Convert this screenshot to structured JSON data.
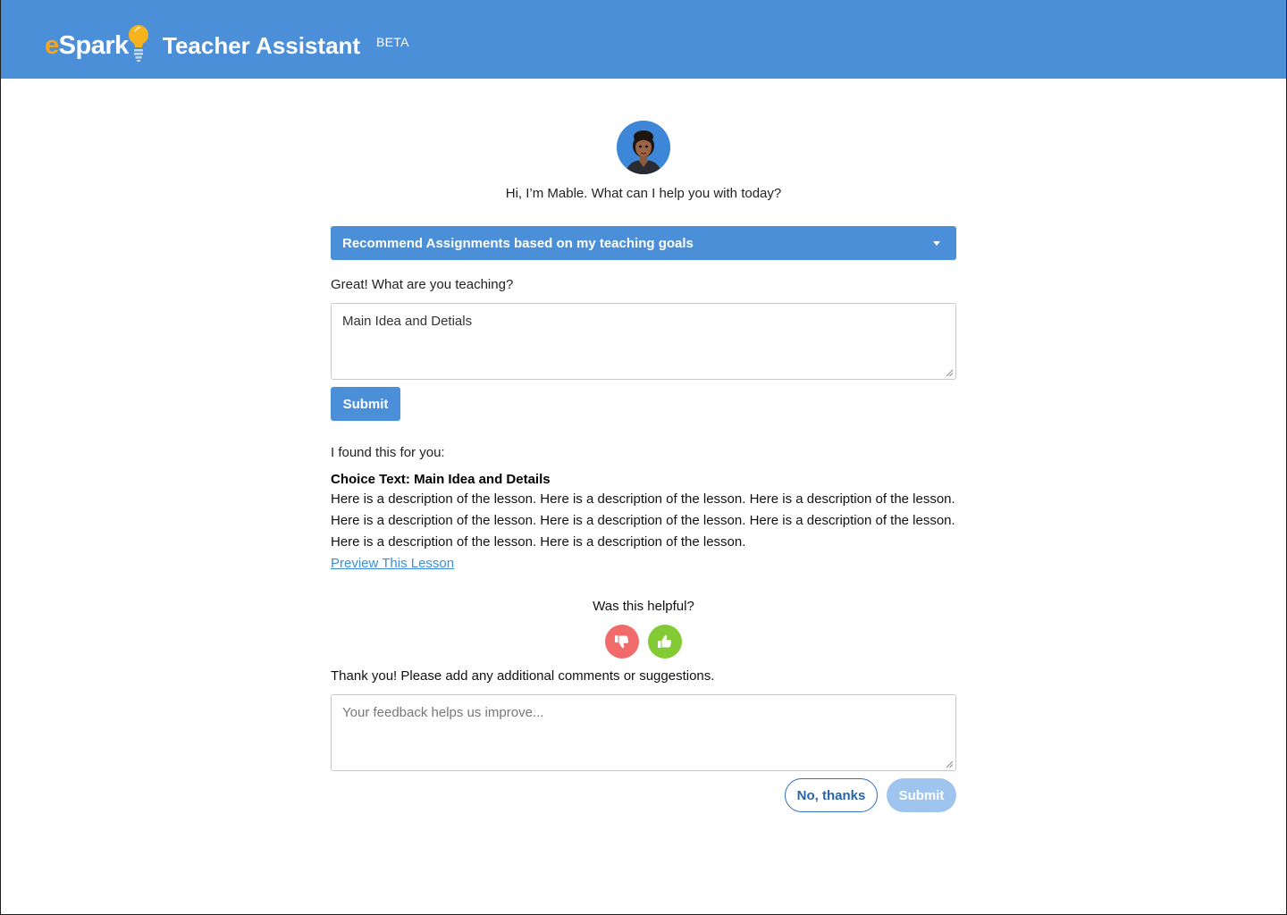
{
  "header": {
    "logo_e": "e",
    "logo_spark": "Spark",
    "title": "Teacher Assistant",
    "badge": "BETA",
    "bg_color": "#4a8fd8"
  },
  "assistant": {
    "greeting": "Hi, I’m Mable. What can I help you with today?"
  },
  "task_select": {
    "selected": "Recommend Assignments based on my teaching goals"
  },
  "teaching_form": {
    "question": "Great! What are you teaching?",
    "value": "Main Idea and Detials",
    "submit_label": "Submit"
  },
  "result": {
    "intro": "I found this for you:",
    "title": "Choice Text: Main Idea and Details",
    "description": "Here is a description of the lesson. Here is a description of the lesson. Here is a description of the lesson. Here is a description of the lesson. Here is a description of the lesson. Here is a description of the lesson. Here is a description of the lesson. Here is a description of the lesson.",
    "link_label": "Preview This Lesson"
  },
  "feedback": {
    "question": "Was this helpful?",
    "thumbs_down_color": "#f26b6b",
    "thumbs_up_color": "#82cb35",
    "thanks_text": "Thank you! Please add any additional comments or suggestions.",
    "placeholder": "Your feedback helps us improve...",
    "no_thanks_label": "No, thanks",
    "submit_label": "Submit"
  }
}
